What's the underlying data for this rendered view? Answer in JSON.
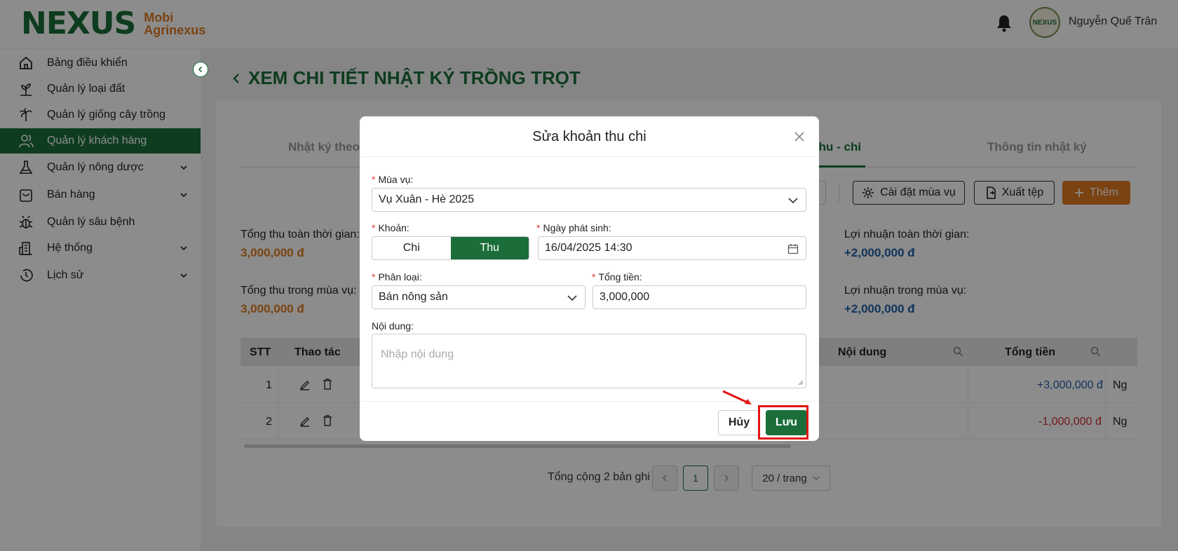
{
  "header": {
    "logo_mark": "NEXUS",
    "logo_line1": "Mobi",
    "logo_line2": "Agrinexus",
    "avatar_text": "NEXUS",
    "username": "Nguyễn Quế Trân"
  },
  "sidebar": {
    "items": [
      {
        "label": "Bảng điều khiển",
        "icon": "home-icon"
      },
      {
        "label": "Quản lý loại đất",
        "icon": "soil-plant-icon"
      },
      {
        "label": "Quản lý giống cây trồng",
        "icon": "palm-tree-icon"
      },
      {
        "label": "Quản lý khách hàng",
        "icon": "users-icon",
        "active": true
      },
      {
        "label": "Quản lý nông dược",
        "icon": "flask-icon",
        "has_submenu": true
      },
      {
        "label": "Bán hàng",
        "icon": "shopping-bag-icon",
        "has_submenu": true
      },
      {
        "label": "Quản lý sâu bệnh",
        "icon": "bug-icon"
      },
      {
        "label": "Hệ thống",
        "icon": "building-icon",
        "has_submenu": true
      },
      {
        "label": "Lịch sử",
        "icon": "history-clock-icon",
        "has_submenu": true
      }
    ]
  },
  "page": {
    "title": "XEM CHI TIẾT NHẬT KÝ TRỒNG TRỌT",
    "tabs": [
      "Nhật ký theo",
      "thu - chi",
      "Thông tin nhật ký"
    ],
    "active_tab": "thu - chi",
    "actions": {
      "season_settings": "Cài đặt mùa vụ",
      "export": "Xuất tệp",
      "add": "Thêm"
    },
    "stats": {
      "total_income_all_label": "Tổng thu toàn thời gian:",
      "total_income_all_value": "3,000,000 đ",
      "total_income_season_label": "Tổng thu trong mùa vụ:",
      "total_income_season_value": "3,000,000 đ",
      "profit_all_label": "Lợi nhuận toàn thời gian:",
      "profit_all_value": "+2,000,000 đ",
      "profit_season_label": "Lợi nhuận trong mùa vụ:",
      "profit_season_value": "+2,000,000 đ"
    },
    "table": {
      "columns": [
        "STT",
        "Thao tác",
        "Nội dung",
        "Tổng tiền"
      ],
      "rows": [
        {
          "stt": "1",
          "amount": "+3,000,000 đ",
          "extra": "Ng"
        },
        {
          "stt": "2",
          "amount": "-1,000,000 đ",
          "extra": "Ng"
        }
      ]
    },
    "pagination": {
      "total_text": "Tổng cộng 2 bản ghi",
      "current_page": "1",
      "page_size": "20 / trang"
    }
  },
  "modal": {
    "title": "Sửa khoản thu chi",
    "season_label": "Mùa vụ:",
    "season_value": "Vụ Xuân - Hè 2025",
    "type_label": "Khoản:",
    "type_options": [
      "Chi",
      "Thu"
    ],
    "type_selected": "Thu",
    "date_label": "Ngày phát sinh:",
    "date_value": "16/04/2025 14:30",
    "category_label": "Phân loại:",
    "category_value": "Bán nông sản",
    "amount_label": "Tổng tiền:",
    "amount_value": "3,000,000",
    "content_label": "Nội dung:",
    "content_placeholder": "Nhập nội dung",
    "cancel_label": "Hủy",
    "save_label": "Lưu"
  },
  "colors": {
    "brand_green": "#1b6e3a",
    "accent_orange": "#e07a1f",
    "profit_blue": "#1f5fa8",
    "negative_red": "#d32f2f",
    "highlight_red": "#e01414"
  }
}
